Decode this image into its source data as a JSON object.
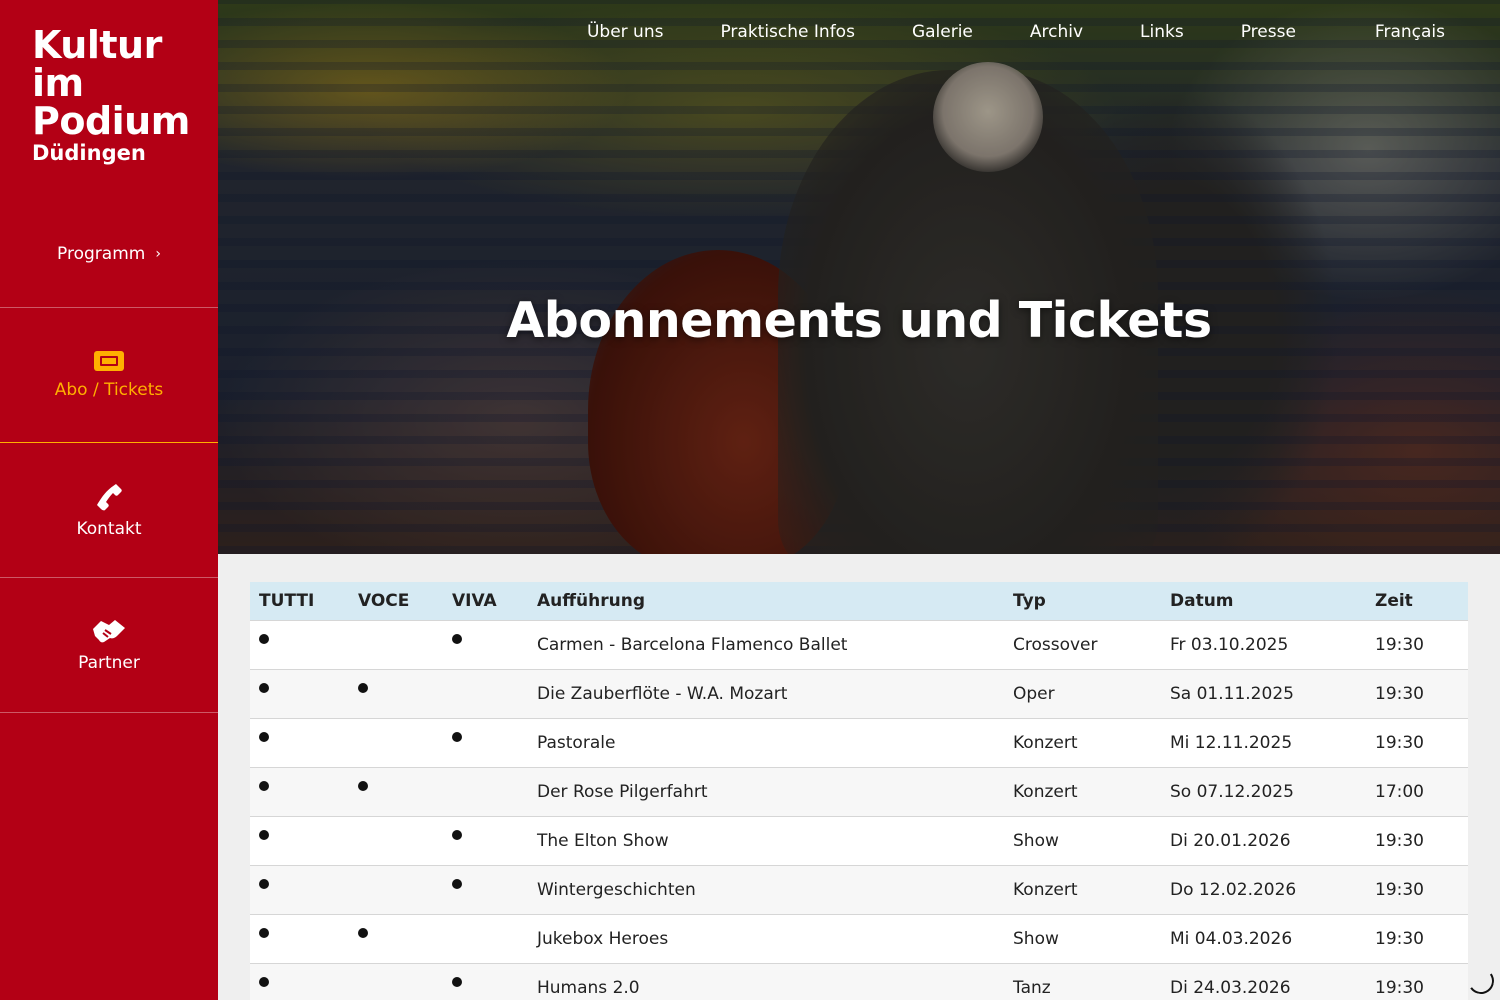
{
  "logo": {
    "line1": "Kultur",
    "line2": "im",
    "line3": "Podium",
    "line4": "Düdingen"
  },
  "sidebar": {
    "items": [
      {
        "label": "Programm",
        "icon": "chevron-right-icon"
      },
      {
        "label": "Abo / Tickets",
        "icon": "ticket-icon",
        "active": true
      },
      {
        "label": "Kontakt",
        "icon": "phone-icon"
      },
      {
        "label": "Partner",
        "icon": "handshake-icon"
      }
    ]
  },
  "topnav": {
    "items": [
      "Über uns",
      "Praktische Infos",
      "Galerie",
      "Archiv",
      "Links",
      "Presse"
    ],
    "language": "Français"
  },
  "hero": {
    "title": "Abonnements und Tickets"
  },
  "table": {
    "headers": [
      "TUTTI",
      "VOCE",
      "VIVA",
      "Aufführung",
      "Typ",
      "Datum",
      "Zeit"
    ],
    "rows": [
      {
        "tutti": true,
        "voce": false,
        "viva": true,
        "title": "Carmen - Barcelona Flamenco Ballet",
        "typ": "Crossover",
        "datum": "Fr 03.10.2025",
        "zeit": "19:30"
      },
      {
        "tutti": true,
        "voce": true,
        "viva": false,
        "title": "Die Zauberflöte - W.A. Mozart",
        "typ": "Oper",
        "datum": "Sa 01.11.2025",
        "zeit": "19:30"
      },
      {
        "tutti": true,
        "voce": false,
        "viva": true,
        "title": "Pastorale",
        "typ": "Konzert",
        "datum": "Mi 12.11.2025",
        "zeit": "19:30"
      },
      {
        "tutti": true,
        "voce": true,
        "viva": false,
        "title": "Der Rose Pilgerfahrt",
        "typ": "Konzert",
        "datum": "So 07.12.2025",
        "zeit": "17:00"
      },
      {
        "tutti": true,
        "voce": false,
        "viva": true,
        "title": "The Elton Show",
        "typ": "Show",
        "datum": "Di 20.01.2026",
        "zeit": "19:30"
      },
      {
        "tutti": true,
        "voce": false,
        "viva": true,
        "title": "Wintergeschichten",
        "typ": "Konzert",
        "datum": "Do 12.02.2026",
        "zeit": "19:30"
      },
      {
        "tutti": true,
        "voce": true,
        "viva": false,
        "title": "Jukebox Heroes",
        "typ": "Show",
        "datum": "Mi 04.03.2026",
        "zeit": "19:30"
      },
      {
        "tutti": true,
        "voce": false,
        "viva": true,
        "title": "Humans 2.0",
        "typ": "Tanz",
        "datum": "Di 24.03.2026",
        "zeit": "19:30"
      }
    ]
  },
  "colors": {
    "brand_red": "#b30015",
    "active_accent": "#ffb000",
    "table_header_bg": "#d6eaf3"
  }
}
